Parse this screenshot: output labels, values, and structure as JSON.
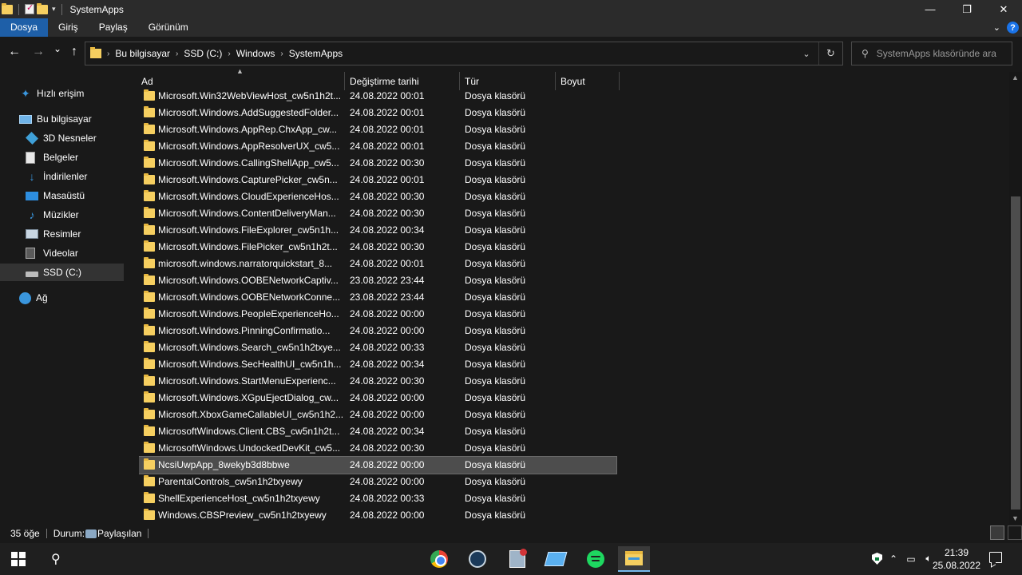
{
  "window": {
    "title": "SystemApps",
    "controls": {
      "minimize": "—",
      "maximize": "❐",
      "close": "✕"
    }
  },
  "ribbon": {
    "tabs": [
      "Dosya",
      "Giriş",
      "Paylaş",
      "Görünüm"
    ],
    "active_tab": "Dosya",
    "help": "?"
  },
  "nav": {
    "back": "←",
    "forward": "→",
    "recent": "⌄",
    "up": "↑"
  },
  "address": {
    "breadcrumbs": [
      "Bu bilgisayar",
      "SSD (C:)",
      "Windows",
      "SystemApps"
    ]
  },
  "search": {
    "placeholder": "SystemApps klasöründe ara"
  },
  "sidebar": {
    "items": [
      {
        "label": "Hızlı erişim",
        "icon": "star-icon"
      },
      {
        "label": "Bu bilgisayar",
        "icon": "computer-icon"
      },
      {
        "label": "3D Nesneler",
        "icon": "3d-objects-icon"
      },
      {
        "label": "Belgeler",
        "icon": "documents-icon"
      },
      {
        "label": "İndirilenler",
        "icon": "download-icon"
      },
      {
        "label": "Masaüstü",
        "icon": "desktop-icon"
      },
      {
        "label": "Müzikler",
        "icon": "music-icon"
      },
      {
        "label": "Resimler",
        "icon": "pictures-icon"
      },
      {
        "label": "Videolar",
        "icon": "video-icon"
      },
      {
        "label": "SSD (C:)",
        "icon": "drive-icon"
      },
      {
        "label": "Ağ",
        "icon": "network-icon"
      }
    ],
    "selected": "SSD (C:)"
  },
  "columns": {
    "name": "Ad",
    "date": "Değiştirme tarihi",
    "type": "Tür",
    "size": "Boyut"
  },
  "files": [
    {
      "name": "Microsoft.Win32WebViewHost_cw5n1h2t...",
      "date": "24.08.2022 00:01",
      "type": "Dosya klasörü"
    },
    {
      "name": "Microsoft.Windows.AddSuggestedFolder...",
      "date": "24.08.2022 00:01",
      "type": "Dosya klasörü"
    },
    {
      "name": "Microsoft.Windows.AppRep.ChxApp_cw...",
      "date": "24.08.2022 00:01",
      "type": "Dosya klasörü"
    },
    {
      "name": "Microsoft.Windows.AppResolverUX_cw5...",
      "date": "24.08.2022 00:01",
      "type": "Dosya klasörü"
    },
    {
      "name": "Microsoft.Windows.CallingShellApp_cw5...",
      "date": "24.08.2022 00:30",
      "type": "Dosya klasörü"
    },
    {
      "name": "Microsoft.Windows.CapturePicker_cw5n...",
      "date": "24.08.2022 00:01",
      "type": "Dosya klasörü"
    },
    {
      "name": "Microsoft.Windows.CloudExperienceHos...",
      "date": "24.08.2022 00:30",
      "type": "Dosya klasörü"
    },
    {
      "name": "Microsoft.Windows.ContentDeliveryMan...",
      "date": "24.08.2022 00:30",
      "type": "Dosya klasörü"
    },
    {
      "name": "Microsoft.Windows.FileExplorer_cw5n1h...",
      "date": "24.08.2022 00:34",
      "type": "Dosya klasörü"
    },
    {
      "name": "Microsoft.Windows.FilePicker_cw5n1h2t...",
      "date": "24.08.2022 00:30",
      "type": "Dosya klasörü"
    },
    {
      "name": "microsoft.windows.narratorquickstart_8...",
      "date": "24.08.2022 00:01",
      "type": "Dosya klasörü"
    },
    {
      "name": "Microsoft.Windows.OOBENetworkCaptiv...",
      "date": "23.08.2022 23:44",
      "type": "Dosya klasörü"
    },
    {
      "name": "Microsoft.Windows.OOBENetworkConne...",
      "date": "23.08.2022 23:44",
      "type": "Dosya klasörü"
    },
    {
      "name": "Microsoft.Windows.PeopleExperienceHo...",
      "date": "24.08.2022 00:00",
      "type": "Dosya klasörü"
    },
    {
      "name": "Microsoft.Windows.PinningConfirmatio...",
      "date": "24.08.2022 00:00",
      "type": "Dosya klasörü"
    },
    {
      "name": "Microsoft.Windows.Search_cw5n1h2txye...",
      "date": "24.08.2022 00:33",
      "type": "Dosya klasörü"
    },
    {
      "name": "Microsoft.Windows.SecHealthUI_cw5n1h...",
      "date": "24.08.2022 00:34",
      "type": "Dosya klasörü"
    },
    {
      "name": "Microsoft.Windows.StartMenuExperienc...",
      "date": "24.08.2022 00:30",
      "type": "Dosya klasörü"
    },
    {
      "name": "Microsoft.Windows.XGpuEjectDialog_cw...",
      "date": "24.08.2022 00:00",
      "type": "Dosya klasörü"
    },
    {
      "name": "Microsoft.XboxGameCallableUI_cw5n1h2...",
      "date": "24.08.2022 00:00",
      "type": "Dosya klasörü"
    },
    {
      "name": "MicrosoftWindows.Client.CBS_cw5n1h2t...",
      "date": "24.08.2022 00:34",
      "type": "Dosya klasörü"
    },
    {
      "name": "MicrosoftWindows.UndockedDevKit_cw5...",
      "date": "24.08.2022 00:30",
      "type": "Dosya klasörü"
    },
    {
      "name": "NcsiUwpApp_8wekyb3d8bbwe",
      "date": "24.08.2022 00:00",
      "type": "Dosya klasörü",
      "selected": true
    },
    {
      "name": "ParentalControls_cw5n1h2txyewy",
      "date": "24.08.2022 00:00",
      "type": "Dosya klasörü"
    },
    {
      "name": "ShellExperienceHost_cw5n1h2txyewy",
      "date": "24.08.2022 00:33",
      "type": "Dosya klasörü"
    },
    {
      "name": "Windows.CBSPreview_cw5n1h2txyewy",
      "date": "24.08.2022 00:00",
      "type": "Dosya klasörü"
    }
  ],
  "status": {
    "count": "35 öğe",
    "state_label": "Durum:",
    "state_value": "Paylaşılan"
  },
  "taskbar": {
    "apps": [
      {
        "name": "chrome-icon"
      },
      {
        "name": "steam-icon"
      },
      {
        "name": "app-icon"
      },
      {
        "name": "app-icon"
      },
      {
        "name": "spotify-icon"
      },
      {
        "name": "file-explorer-icon",
        "active": true
      }
    ],
    "clock": {
      "time": "21:39",
      "date": "25.08.2022"
    }
  }
}
